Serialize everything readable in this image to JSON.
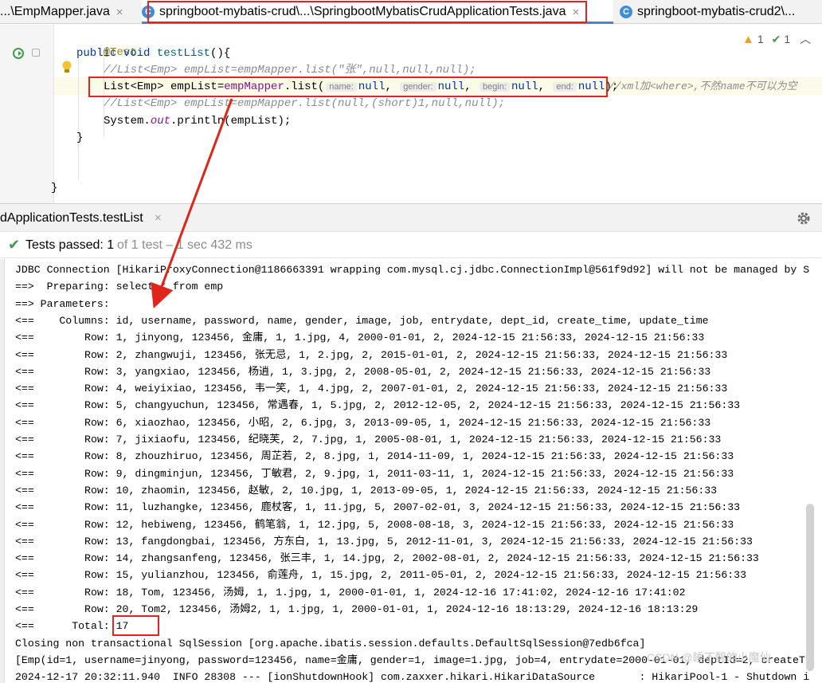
{
  "tabs": [
    {
      "label": "...\\EmpMapper.java",
      "close": "×"
    },
    {
      "label": "springboot-mybatis-crud\\...\\SpringbootMybatisCrudApplicationTests.java",
      "close": "×"
    },
    {
      "label": "springboot-mybatis-crud2\\...",
      "close": ""
    }
  ],
  "editor": {
    "inspections": {
      "warnings": "1",
      "ok": "1"
    },
    "annotation": "@Test",
    "sig_kw": "public void",
    "sig_name": "testList",
    "sig_rest": "(){",
    "comment1": "//List<Emp> empList=empMapper.list(\"张\",null,null,null);",
    "line_prefix": "List<Emp> empList=",
    "line_field": "empMapper",
    "line_call": ".list(",
    "hints": [
      {
        "name": "name:",
        "value": "null"
      },
      {
        "name": "gender:",
        "value": "null"
      },
      {
        "name": "begin:",
        "value": "null"
      },
      {
        "name": "end:",
        "value": "null"
      }
    ],
    "sep": ",",
    "line_close": ");",
    "line_comment": "//xml加<where>,不然name不可以为空",
    "comment2": "//List<Emp> empList=empMapper.list(null,(short)1,null,null);",
    "print_a": "System.",
    "print_out": "out",
    "print_b": ".println(empList);",
    "close_method": "}",
    "close_class": "}"
  },
  "run": {
    "title": "dApplicationTests.testList",
    "close": "×",
    "status_main": "Tests passed: 1",
    "status_rest": "of 1 test – 1 sec 432 ms"
  },
  "console": {
    "lines": [
      "JDBC Connection [HikariProxyConnection@1186663391 wrapping com.mysql.cj.jdbc.ConnectionImpl@561f9d92] will not be managed by S",
      "==>  Preparing: select * from emp",
      "==> Parameters: ",
      "<==    Columns: id, username, password, name, gender, image, job, entrydate, dept_id, create_time, update_time",
      "<==        Row: 1, jinyong, 123456, 金庸, 1, 1.jpg, 4, 2000-01-01, 2, 2024-12-15 21:56:33, 2024-12-15 21:56:33",
      "<==        Row: 2, zhangwuji, 123456, 张无忌, 1, 2.jpg, 2, 2015-01-01, 2, 2024-12-15 21:56:33, 2024-12-15 21:56:33",
      "<==        Row: 3, yangxiao, 123456, 杨逍, 1, 3.jpg, 2, 2008-05-01, 2, 2024-12-15 21:56:33, 2024-12-15 21:56:33",
      "<==        Row: 4, weiyixiao, 123456, 韦一笑, 1, 4.jpg, 2, 2007-01-01, 2, 2024-12-15 21:56:33, 2024-12-15 21:56:33",
      "<==        Row: 5, changyuchun, 123456, 常遇春, 1, 5.jpg, 2, 2012-12-05, 2, 2024-12-15 21:56:33, 2024-12-15 21:56:33",
      "<==        Row: 6, xiaozhao, 123456, 小昭, 2, 6.jpg, 3, 2013-09-05, 1, 2024-12-15 21:56:33, 2024-12-15 21:56:33",
      "<==        Row: 7, jixiaofu, 123456, 纪晓芙, 2, 7.jpg, 1, 2005-08-01, 1, 2024-12-15 21:56:33, 2024-12-15 21:56:33",
      "<==        Row: 8, zhouzhiruo, 123456, 周芷若, 2, 8.jpg, 1, 2014-11-09, 1, 2024-12-15 21:56:33, 2024-12-15 21:56:33",
      "<==        Row: 9, dingminjun, 123456, 丁敏君, 2, 9.jpg, 1, 2011-03-11, 1, 2024-12-15 21:56:33, 2024-12-15 21:56:33",
      "<==        Row: 10, zhaomin, 123456, 赵敏, 2, 10.jpg, 1, 2013-09-05, 1, 2024-12-15 21:56:33, 2024-12-15 21:56:33",
      "<==        Row: 11, luzhangke, 123456, 鹿杖客, 1, 11.jpg, 5, 2007-02-01, 3, 2024-12-15 21:56:33, 2024-12-15 21:56:33",
      "<==        Row: 12, hebiweng, 123456, 鹤笔翁, 1, 12.jpg, 5, 2008-08-18, 3, 2024-12-15 21:56:33, 2024-12-15 21:56:33",
      "<==        Row: 13, fangdongbai, 123456, 方东白, 1, 13.jpg, 5, 2012-11-01, 3, 2024-12-15 21:56:33, 2024-12-15 21:56:33",
      "<==        Row: 14, zhangsanfeng, 123456, 张三丰, 1, 14.jpg, 2, 2002-08-01, 2, 2024-12-15 21:56:33, 2024-12-15 21:56:33",
      "<==        Row: 15, yulianzhou, 123456, 俞莲舟, 1, 15.jpg, 2, 2011-05-01, 2, 2024-12-15 21:56:33, 2024-12-15 21:56:33",
      "<==        Row: 18, Tom, 123456, 汤姆, 1, 1.jpg, 1, 2000-01-01, 1, 2024-12-16 17:41:02, 2024-12-16 17:41:02",
      "<==        Row: 20, Tom2, 123456, 汤姆2, 1, 1.jpg, 1, 2000-01-01, 1, 2024-12-16 18:13:29, 2024-12-16 18:13:29",
      "<==      Total: 17",
      "Closing non transactional SqlSession [org.apache.ibatis.session.defaults.DefaultSqlSession@7edb6fca]",
      "[Emp(id=1, username=jinyong, password=123456, name=金庸, gender=1, image=1.jpg, job=4, entrydate=2000-01-01, deptId=2, createT",
      "2024-12-17 20:32:11.940  INFO 28308 --- [ionShutdownHook] com.zaxxer.hikari.HikariDataSource       : HikariPool-1 - Shutdown i"
    ],
    "watermark": "CSDN @睡不醒的小魔仙"
  },
  "colors": {
    "accent": "#4a83cf",
    "highlight_box": "#e0251b",
    "success": "#3f9a4a"
  }
}
